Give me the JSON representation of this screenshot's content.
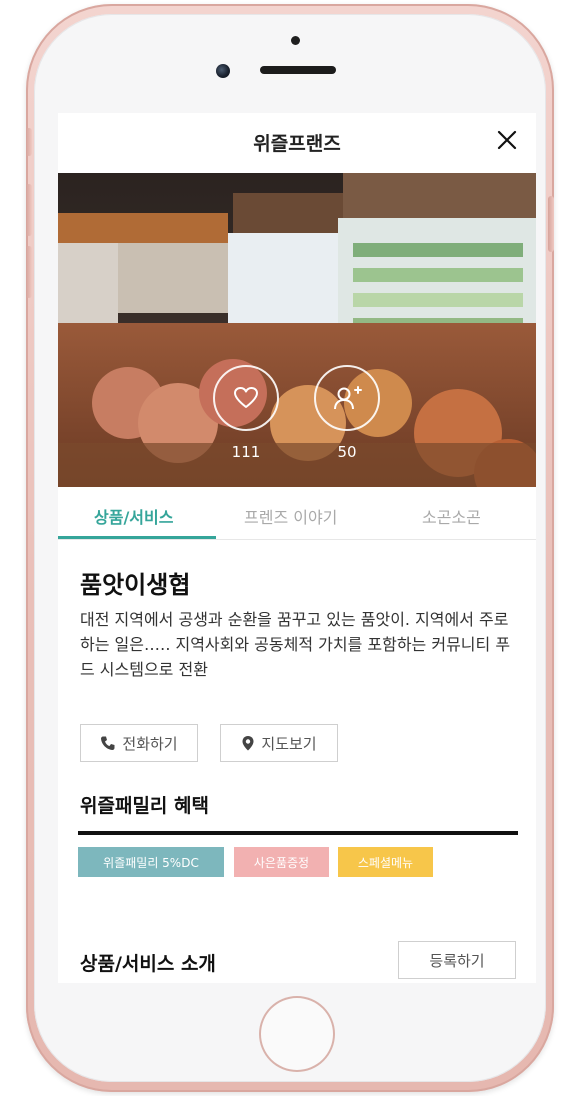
{
  "app": {
    "title": "위즐프랜즈",
    "close_icon": "close-icon"
  },
  "hero": {
    "like_count": "111",
    "follow_count": "50",
    "like_icon": "heart-icon",
    "follow_icon": "add-user-icon"
  },
  "tabs": [
    {
      "label": "상품/서비스",
      "active": true
    },
    {
      "label": "프렌즈 이야기",
      "active": false
    },
    {
      "label": "소곤소곤",
      "active": false
    }
  ],
  "store": {
    "name": "품앗이생협",
    "description": "대전 지역에서 공생과 순환을 꿈꾸고 있는 품앗이. 지역에서 주로 하는 일은‥‥. 지역사회와 공동체적 가치를 포함하는 커뮤니티 푸드 시스템으로 전환"
  },
  "actions": {
    "call_label": "전화하기",
    "map_label": "지도보기"
  },
  "benefits": {
    "title": "위즐패밀리 혜택",
    "badges": [
      {
        "label": "위즐패밀리 5%DC",
        "color": "#7db7bd"
      },
      {
        "label": "사은품증정",
        "color": "#f2b1b1"
      },
      {
        "label": "스페셜메뉴",
        "color": "#f7c64a"
      }
    ]
  },
  "intro": {
    "title": "상품/서비스 소개",
    "register_label": "등록하기"
  },
  "colors": {
    "accent": "#35a59a",
    "phone_frame": "#e9bfb8"
  }
}
